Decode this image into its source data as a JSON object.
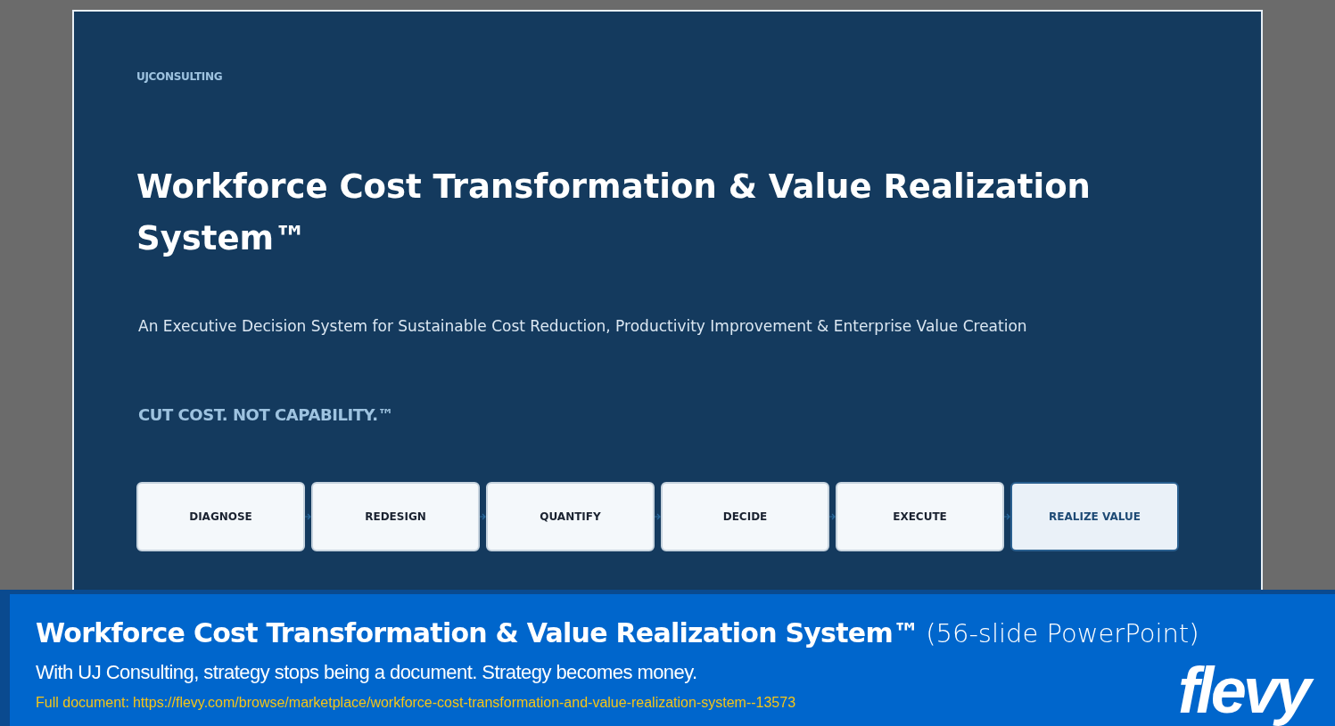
{
  "slide": {
    "brand": "UJCONSULTING",
    "title": "Workforce Cost Transformation & Value Realization System™",
    "subtitle": "An Executive Decision System for Sustainable Cost Reduction, Productivity Improvement & Enterprise Value Creation",
    "tagline": "CUT COST. NOT CAPABILITY.™",
    "steps": [
      {
        "label": "DIAGNOSE",
        "highlighted": false
      },
      {
        "label": "REDESIGN",
        "highlighted": false
      },
      {
        "label": "QUANTIFY",
        "highlighted": false
      },
      {
        "label": "DECIDE",
        "highlighted": false
      },
      {
        "label": "EXECUTE",
        "highlighted": false
      },
      {
        "label": "REALIZE VALUE",
        "highlighted": true
      }
    ]
  },
  "banner": {
    "title": "Workforce Cost Transformation & Value Realization System™",
    "title_note": "(56-slide PowerPoint)",
    "description": "With UJ Consulting, strategy stops being a document. Strategy becomes money.",
    "link_label": "Full document:",
    "link": "https://flevy.com/browse/marketplace/workforce-cost-transformation-and-value-realization-system--13573",
    "logo": "flevy"
  }
}
